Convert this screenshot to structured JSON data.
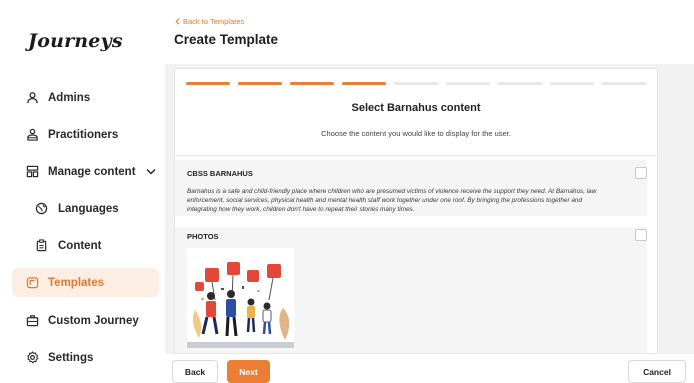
{
  "app": {
    "logo": "Journeys"
  },
  "sidebar": {
    "items": [
      {
        "label": "Admins",
        "icon": "user-icon"
      },
      {
        "label": "Practitioners",
        "icon": "users-icon"
      },
      {
        "label": "Manage content",
        "icon": "layout-icon",
        "expanded": true
      },
      {
        "label": "Languages",
        "icon": "globe-icon"
      },
      {
        "label": "Content",
        "icon": "clipboard-icon"
      },
      {
        "label": "Templates",
        "icon": "template-icon",
        "active": true
      },
      {
        "label": "Custom Journey",
        "icon": "briefcase-icon"
      },
      {
        "label": "Settings",
        "icon": "gear-icon"
      }
    ]
  },
  "header": {
    "back_label": "Back to Templates",
    "title": "Create Template"
  },
  "wizard": {
    "steps_total": 9,
    "steps_completed": 4,
    "title": "Select Barnahus content",
    "subtitle": "Choose the content you would like to display for the user."
  },
  "sections": {
    "cbss": {
      "label": "CBSS BARNAHUS",
      "checked": false,
      "text": "Barnahus is a safe and child-friendly place where children who are presumed victims of violence receive the support they need. At Barnahus, law enforcement, social services, physical health and mental health staff work together under one roof. By bringing the professions together and integrating how they work, children don't have to repeat their stories many times."
    },
    "photos": {
      "label": "PHOTOS",
      "checked": false
    }
  },
  "footer": {
    "back_label": "Back",
    "next_label": "Next",
    "cancel_label": "Cancel"
  },
  "colors": {
    "accent": "#e97f39",
    "active_bg": "#fdeee4",
    "main_bg": "#f2f2f2"
  }
}
